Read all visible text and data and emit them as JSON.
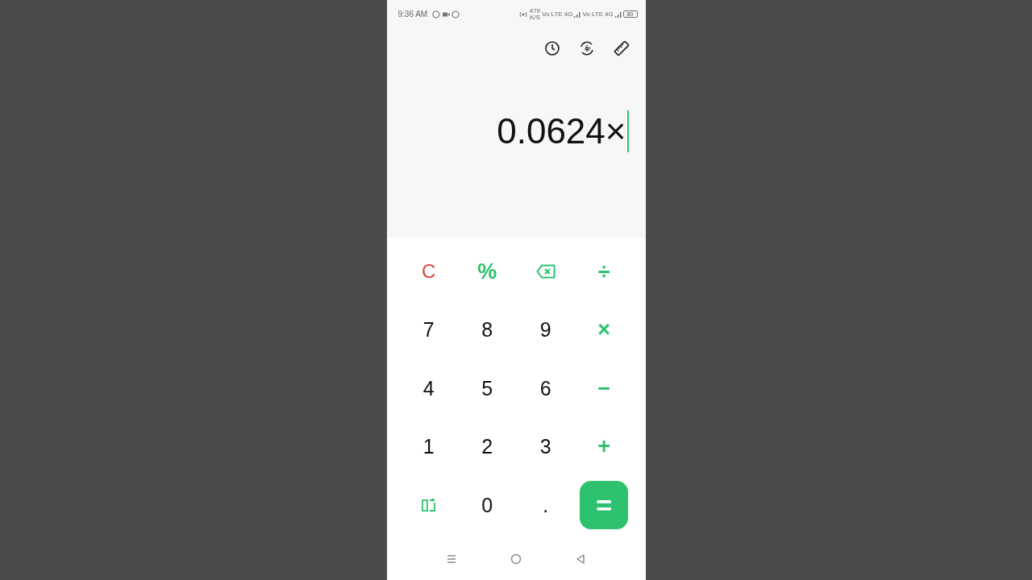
{
  "status_bar": {
    "time": "9:36 AM",
    "speed": "479",
    "speed_unit": "K/S",
    "network_1": "Vo LTE",
    "network_1_type": "4G",
    "network_2": "Vo LTE",
    "network_2_type": "4G",
    "battery": "80"
  },
  "display": {
    "expression": "0.0624×"
  },
  "keys": [
    {
      "kind": "clear",
      "label": "C"
    },
    {
      "kind": "operator",
      "label": "%"
    },
    {
      "kind": "backspace"
    },
    {
      "kind": "operator",
      "label": "÷"
    },
    {
      "kind": "digit",
      "label": "7"
    },
    {
      "kind": "digit",
      "label": "8"
    },
    {
      "kind": "digit",
      "label": "9"
    },
    {
      "kind": "operator",
      "label": "×"
    },
    {
      "kind": "digit",
      "label": "4"
    },
    {
      "kind": "digit",
      "label": "5"
    },
    {
      "kind": "digit",
      "label": "6"
    },
    {
      "kind": "operator",
      "label": "−"
    },
    {
      "kind": "digit",
      "label": "1"
    },
    {
      "kind": "digit",
      "label": "2"
    },
    {
      "kind": "digit",
      "label": "3"
    },
    {
      "kind": "operator",
      "label": "+"
    },
    {
      "kind": "rotate"
    },
    {
      "kind": "digit",
      "label": "0"
    },
    {
      "kind": "digit",
      "label": "."
    },
    {
      "kind": "equals",
      "label": "="
    }
  ]
}
